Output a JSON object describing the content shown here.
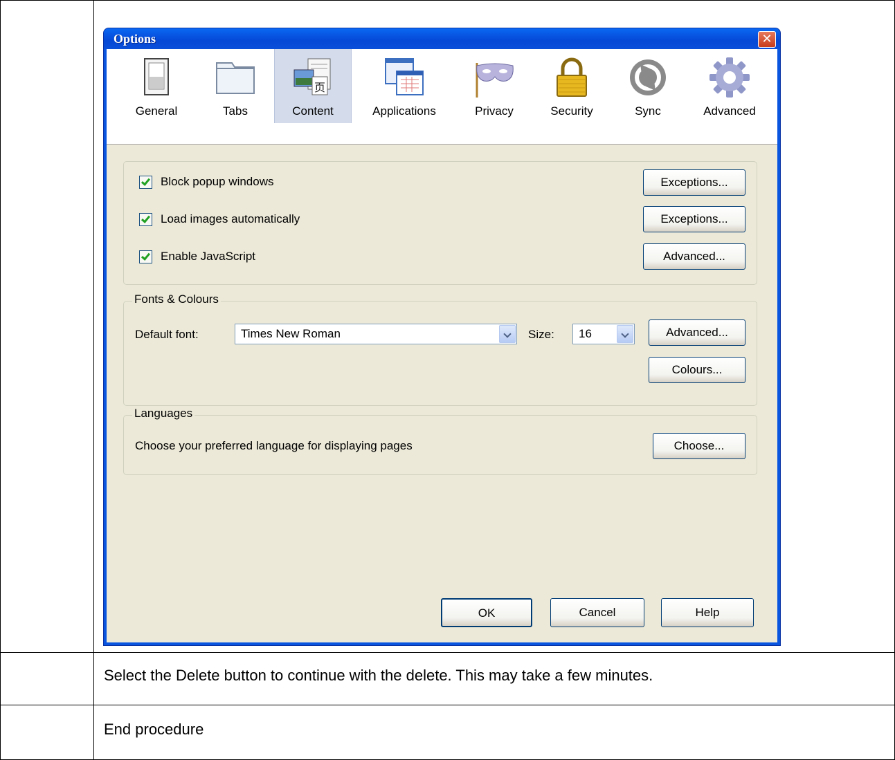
{
  "dialog": {
    "title": "Options",
    "close_glyph": "✕",
    "tabs": [
      {
        "label": "General",
        "icon": "general-icon"
      },
      {
        "label": "Tabs",
        "icon": "tabs-icon"
      },
      {
        "label": "Content",
        "icon": "content-icon",
        "selected": true
      },
      {
        "label": "Applications",
        "icon": "applications-icon"
      },
      {
        "label": "Privacy",
        "icon": "privacy-mask-icon"
      },
      {
        "label": "Security",
        "icon": "padlock-icon"
      },
      {
        "label": "Sync",
        "icon": "sync-icon"
      },
      {
        "label": "Advanced",
        "icon": "gear-icon"
      }
    ],
    "content": {
      "block_popups": {
        "label": "Block popup windows",
        "checked": true,
        "button": "Exceptions..."
      },
      "load_images": {
        "label": "Load images automatically",
        "checked": true,
        "button": "Exceptions..."
      },
      "enable_js": {
        "label": "Enable JavaScript",
        "checked": true,
        "button": "Advanced..."
      },
      "fonts": {
        "legend": "Fonts & Colours",
        "default_font_label": "Default font:",
        "default_font_value": "Times New Roman",
        "size_label": "Size:",
        "size_value": "16",
        "advanced_button": "Advanced...",
        "colours_button": "Colours..."
      },
      "languages": {
        "legend": "Languages",
        "description": "Choose your preferred language for displaying pages",
        "choose_button": "Choose..."
      }
    },
    "buttons": {
      "ok": "OK",
      "cancel": "Cancel",
      "help": "Help"
    }
  },
  "document": {
    "step_text": "Select the Delete button to continue with the delete. This may take a few minutes.",
    "end_text": "End procedure"
  },
  "colors": {
    "title_bar": "#0a55e0",
    "dialog_face": "#ece9d8",
    "close_button": "#d3512f",
    "checkmark": "#21a121"
  }
}
